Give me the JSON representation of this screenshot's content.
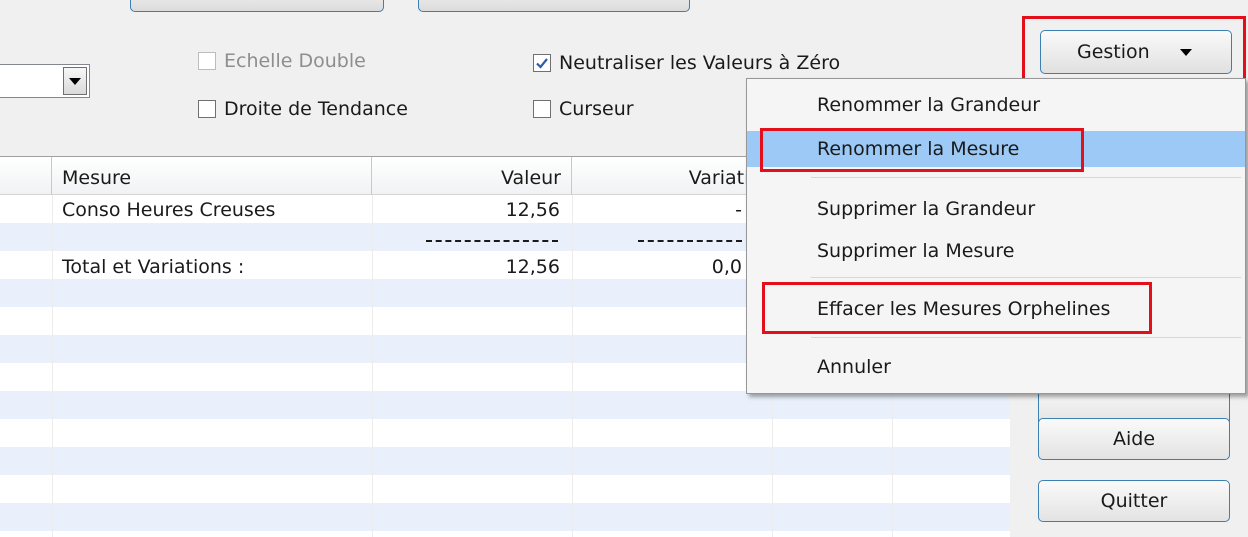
{
  "options": {
    "echelle_double": {
      "label": "Echelle Double",
      "checked": false,
      "enabled": false
    },
    "neutraliser": {
      "label": "Neutraliser les Valeurs à Zéro",
      "checked": true,
      "enabled": true
    },
    "droite_tendance": {
      "label": "Droite de Tendance",
      "checked": false,
      "enabled": true
    },
    "curseur": {
      "label": "Curseur",
      "checked": false,
      "enabled": true
    }
  },
  "table": {
    "columns": [
      "Mesure",
      "Valeur",
      "Variatio"
    ],
    "rows": [
      {
        "mesure": "Conso Heures Creuses",
        "valeur": "12,56",
        "variation": "-"
      },
      {
        "mesure": "Total et Variations :",
        "valeur": "12,56",
        "variation": "0,0"
      }
    ]
  },
  "buttons": {
    "gestion": "Gestion",
    "aide": "Aide",
    "quitter": "Quitter"
  },
  "menu": {
    "items": [
      "Renommer la Grandeur",
      "Renommer la Mesure",
      "Supprimer la Grandeur",
      "Supprimer la Mesure",
      "Effacer les Mesures Orphelines",
      "Annuler"
    ],
    "hovered": "Renommer la Mesure"
  },
  "colors": {
    "highlight_red": "#e3101c",
    "menu_hover": "#9cc9f5",
    "row_stripe": "#e9f0fb",
    "button_border": "#3c7fb1"
  }
}
